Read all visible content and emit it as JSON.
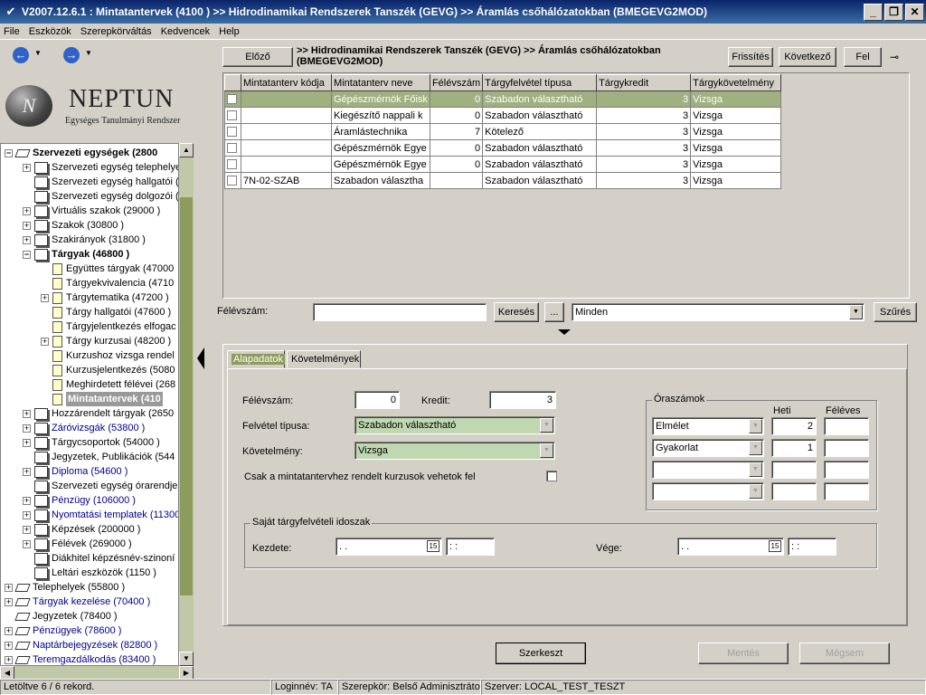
{
  "window": {
    "title": "V2007.12.6.1 : Mintatantervek (4100  )  >> Hidrodinamikai Rendszerek Tanszék (GEVG) >> Áramlás csőhálózatokban (BMEGEVG2MOD)"
  },
  "menu": [
    "File",
    "Eszközök",
    "Szerepkörváltás",
    "Kedvencek",
    "Help"
  ],
  "logo": {
    "name": "NEPTUN",
    "subtitle": "Egységes Tanulmányi Rendszer"
  },
  "tree": [
    {
      "label": "Szervezeti egységek (2800",
      "level": 0,
      "exp": "-",
      "icon": "tag",
      "bold": true,
      "blue": false
    },
    {
      "label": "Szervezeti egység telephelye",
      "level": 1,
      "exp": "+",
      "icon": "pcs"
    },
    {
      "label": "Szervezeti egység hallgatói (",
      "level": 1,
      "exp": "",
      "icon": "pcs"
    },
    {
      "label": "Szervezeti egység dolgozói (",
      "level": 1,
      "exp": "",
      "icon": "pcs"
    },
    {
      "label": "Virtuális szakok (29000  )",
      "level": 1,
      "exp": "+",
      "icon": "pcs"
    },
    {
      "label": "Szakok (30800  )",
      "level": 1,
      "exp": "+",
      "icon": "pcs"
    },
    {
      "label": "Szakirányok (31800  )",
      "level": 1,
      "exp": "+",
      "icon": "pcs"
    },
    {
      "label": "Tárgyak (46800  )",
      "level": 1,
      "exp": "-",
      "icon": "pcs",
      "bold": true
    },
    {
      "label": "Együttes tárgyak (47000",
      "level": 2,
      "exp": "",
      "icon": "doc"
    },
    {
      "label": "Tárgyekvivalencia (4710",
      "level": 2,
      "exp": "",
      "icon": "doc"
    },
    {
      "label": "Tárgytematika (47200  )",
      "level": 2,
      "exp": "+",
      "icon": "doc"
    },
    {
      "label": "Tárgy hallgatói (47600  )",
      "level": 2,
      "exp": "",
      "icon": "doc"
    },
    {
      "label": "Tárgyjelentkezés elfogac",
      "level": 2,
      "exp": "",
      "icon": "doc"
    },
    {
      "label": "Tárgy kurzusai (48200  )",
      "level": 2,
      "exp": "+",
      "icon": "doc"
    },
    {
      "label": "Kurzushoz vizsga rendel",
      "level": 2,
      "exp": "",
      "icon": "doc"
    },
    {
      "label": "Kurzusjelentkezés (5080",
      "level": 2,
      "exp": "",
      "icon": "doc"
    },
    {
      "label": "Meghirdetett félévei (268",
      "level": 2,
      "exp": "",
      "icon": "doc"
    },
    {
      "label": "Mintatantervek (410",
      "level": 2,
      "exp": "",
      "icon": "doc",
      "selected": true
    },
    {
      "label": "Hozzárendelt tárgyak (2650",
      "level": 1,
      "exp": "+",
      "icon": "pcs"
    },
    {
      "label": "Záróvizsgák (53800  )",
      "level": 1,
      "exp": "+",
      "icon": "pcs",
      "blue": true
    },
    {
      "label": "Tárgycsoportok (54000  )",
      "level": 1,
      "exp": "+",
      "icon": "pcs"
    },
    {
      "label": "Jegyzetek, Publikációk (544",
      "level": 1,
      "exp": "",
      "icon": "pcs"
    },
    {
      "label": "Diploma (54600  )",
      "level": 1,
      "exp": "+",
      "icon": "pcs",
      "blue": true
    },
    {
      "label": "Szervezeti egység órarendje",
      "level": 1,
      "exp": "",
      "icon": "pcs"
    },
    {
      "label": "Pénzügy (106000  )",
      "level": 1,
      "exp": "+",
      "icon": "pcs",
      "blue": true
    },
    {
      "label": "Nyomtatási templatek (11300",
      "level": 1,
      "exp": "+",
      "icon": "pcs",
      "blue": true
    },
    {
      "label": "Képzések (200000  )",
      "level": 1,
      "exp": "+",
      "icon": "pcs"
    },
    {
      "label": "Félévek (269000  )",
      "level": 1,
      "exp": "+",
      "icon": "pcs"
    },
    {
      "label": "Diákhitel képzésnév-szinoní",
      "level": 1,
      "exp": "",
      "icon": "pcs"
    },
    {
      "label": "Leltári eszközök (1150  )",
      "level": 1,
      "exp": "",
      "icon": "pcs"
    },
    {
      "label": "Telephelyek (55800  )",
      "level": 0,
      "exp": "+",
      "icon": "tag"
    },
    {
      "label": "Tárgyak kezelése (70400  )",
      "level": 0,
      "exp": "+",
      "icon": "tag",
      "blue": true
    },
    {
      "label": "Jegyzetek (78400  )",
      "level": 0,
      "exp": "",
      "icon": "tag"
    },
    {
      "label": "Pénzügyek (78600  )",
      "level": 0,
      "exp": "+",
      "icon": "tag",
      "blue": true
    },
    {
      "label": "Naptárbejegyzések (82800  )",
      "level": 0,
      "exp": "+",
      "icon": "tag",
      "blue": true
    },
    {
      "label": "Teremgazdálkodás (83400  )",
      "level": 0,
      "exp": "+",
      "icon": "tag",
      "blue": true
    }
  ],
  "toolbar": {
    "prev": "Előző",
    "crumb": ">> Hidrodinamikai Rendszerek Tanszék (GEVG) >> Áramlás csőhálózatokban (BMEGEVG2MOD)",
    "refresh": "Frissítés",
    "next": "Következő",
    "up": "Fel"
  },
  "grid": {
    "columns": [
      "Mintatanterv kódja",
      "Mintatanterv neve",
      "Félévszám",
      "Tárgyfelvétel típusa",
      "Tárgykredit",
      "Tárgykövetelmény"
    ],
    "rows": [
      [
        "",
        "Gépészmérnök Főisk",
        "0",
        "Szabadon választható",
        "3",
        "Vizsga"
      ],
      [
        "",
        "Kiegészítő nappali k",
        "0",
        "Szabadon választható",
        "3",
        "Vizsga"
      ],
      [
        "",
        "Áramlástechnika",
        "7",
        "Kötelező",
        "3",
        "Vizsga"
      ],
      [
        "",
        "Gépészmérnök Egye",
        "0",
        "Szabadon választható",
        "3",
        "Vizsga"
      ],
      [
        "",
        "Gépészmérnök Egye",
        "0",
        "Szabadon választható",
        "3",
        "Vizsga"
      ],
      [
        "7N-02-SZAB",
        "Szabadon választha",
        "",
        "Szabadon választható",
        "3",
        "Vizsga"
      ]
    ]
  },
  "filter": {
    "label": "Félévszám:",
    "search": "Keresés",
    "ellipsis": "...",
    "combo": "Minden",
    "filter_btn": "Szűrés"
  },
  "tabs": [
    "Alapadatok",
    "Követelmények"
  ],
  "form": {
    "felevszam_label": "Félévszám:",
    "felevszam": "0",
    "kredit_label": "Kredit:",
    "kredit": "3",
    "felvetel_label": "Felvétel típusa:",
    "felvetel": "Szabadon választható",
    "kovetelmeny_label": "Követelmény:",
    "kovetelmeny": "Vizsga",
    "csak_label": "Csak a mintatantervhez rendelt kurzusok vehetok fel",
    "oraszamok_title": "Óraszámok",
    "heti": "Heti",
    "feleves": "Féléves",
    "ora_rows": [
      {
        "type": "Elmélet",
        "heti": "2",
        "feleves": ""
      },
      {
        "type": "Gyakorlat",
        "heti": "1",
        "feleves": ""
      },
      {
        "type": "",
        "heti": "",
        "feleves": ""
      },
      {
        "type": "",
        "heti": "",
        "feleves": ""
      }
    ],
    "sajat_title": "Saját tárgyfelvételi idoszak",
    "kezdete_label": "Kezdete:",
    "vege_label": "Vége:",
    "date_placeholder": " .  .",
    "time_placeholder": " :  :"
  },
  "actions": {
    "edit": "Szerkeszt",
    "save": "Mentés",
    "cancel": "Mégsem"
  },
  "status": {
    "records": "Letöltve 6 / 6 rekord.",
    "login": "Loginnév: TA",
    "role": "Szerepkör: Belső Adminisztrátor",
    "server": "Szerver: LOCAL_TEST_TESZT"
  }
}
